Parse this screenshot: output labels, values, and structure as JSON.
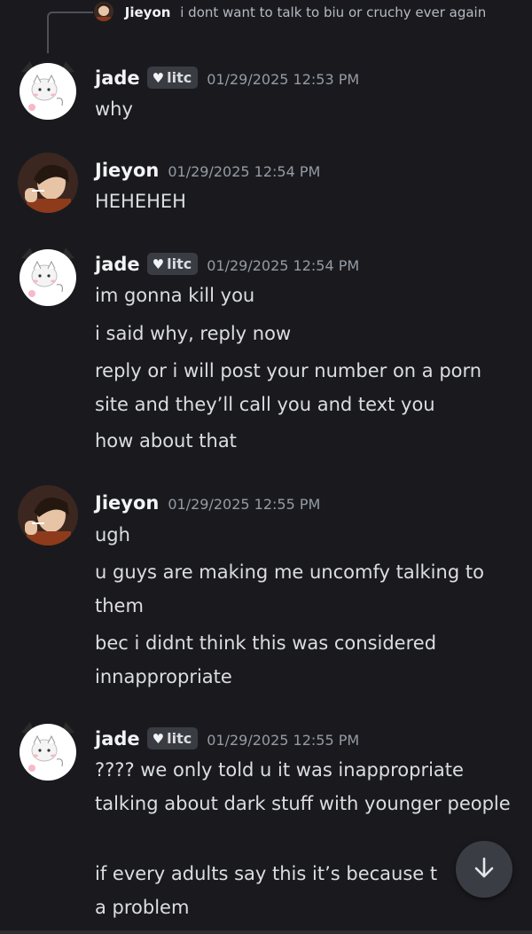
{
  "reply": {
    "author": "Jieyon",
    "text": "i dont want to talk to biu or cruchy ever again"
  },
  "messages": [
    {
      "author": "jade",
      "avatar_icon": "white-cat-avatar-icon",
      "badge": "litc",
      "timestamp": "01/29/2025 12:53 PM",
      "lines": [
        "why"
      ]
    },
    {
      "author": "Jieyon",
      "avatar_icon": "anime-boy-avatar-icon",
      "timestamp": "01/29/2025 12:54 PM",
      "lines": [
        "HEHEHEH"
      ]
    },
    {
      "author": "jade",
      "avatar_icon": "white-cat-avatar-icon",
      "badge": "litc",
      "timestamp": "01/29/2025 12:54 PM",
      "lines": [
        "im gonna kill you",
        "i said why, reply now",
        "reply or i will post your number on a porn site and they’ll call you and text you",
        "how about that"
      ]
    },
    {
      "author": "Jieyon",
      "avatar_icon": "anime-boy-avatar-icon",
      "timestamp": "01/29/2025 12:55 PM",
      "lines": [
        "ugh",
        "u guys are making me uncomfy talking to them",
        "bec i didnt think this was considered innappropriate"
      ]
    },
    {
      "author": "jade",
      "avatar_icon": "white-cat-avatar-icon",
      "badge": "litc",
      "timestamp": "01/29/2025 12:55 PM",
      "lines": [
        "???? we only told u it was inappropriate talking about dark stuff with younger people",
        "if every adults say this it’s because t",
        "a problem"
      ]
    }
  ],
  "scroll_button": {
    "icon": "arrow-down-icon"
  },
  "colors": {
    "background": "#1a1a1e",
    "text": "#dbdee1",
    "timestamp": "#949ba4",
    "badge_bg": "#3a3c43"
  }
}
